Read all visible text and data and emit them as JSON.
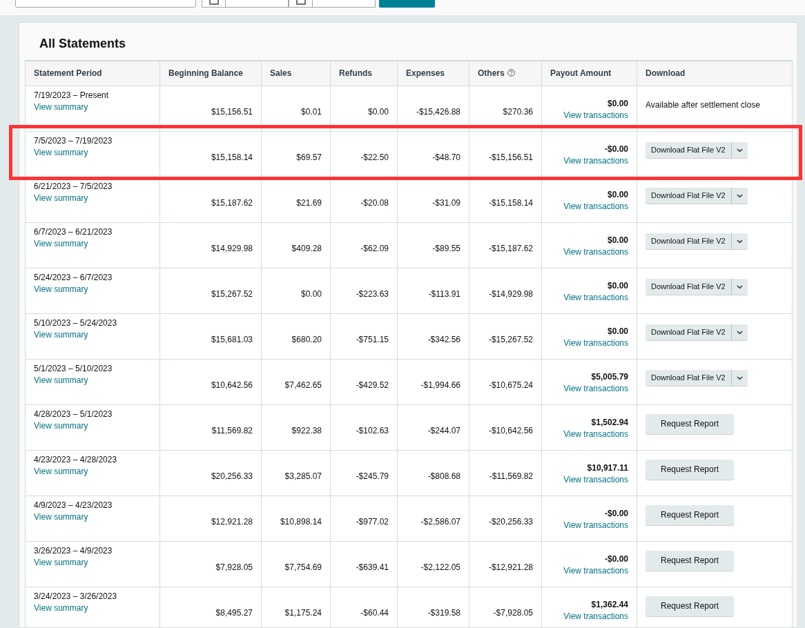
{
  "title": "All Statements",
  "columns": [
    "Statement Period",
    "Beginning Balance",
    "Sales",
    "Refunds",
    "Expenses",
    "Others",
    "Payout Amount",
    "Download"
  ],
  "rows": [
    {
      "period": "7/19/2023 – Present",
      "summary_link": "View summary",
      "beginning": "$15,156.51",
      "sales": "$0.01",
      "refunds": "$0.00",
      "expenses": "-$15,426.88",
      "others": "$270.36",
      "payout": "$0.00",
      "transactions_link": "View transactions",
      "download": {
        "kind": "text",
        "label": "Available after settlement close"
      },
      "highlighted": false
    },
    {
      "period": "7/5/2023 – 7/19/2023",
      "summary_link": "View summary",
      "beginning": "$15,158.14",
      "sales": "$69.57",
      "refunds": "-$22.50",
      "expenses": "-$48.70",
      "others": "-$15,156.51",
      "payout": "-$0.00",
      "transactions_link": "View transactions",
      "download": {
        "kind": "split",
        "label": "Download Flat File V2"
      },
      "highlighted": true
    },
    {
      "period": "6/21/2023 – 7/5/2023",
      "summary_link": "View summary",
      "beginning": "$15,187.62",
      "sales": "$21.69",
      "refunds": "-$20.08",
      "expenses": "-$31.09",
      "others": "-$15,158.14",
      "payout": "$0.00",
      "transactions_link": "View transactions",
      "download": {
        "kind": "split",
        "label": "Download Flat File V2"
      },
      "highlighted": false
    },
    {
      "period": "6/7/2023 – 6/21/2023",
      "summary_link": "View summary",
      "beginning": "$14,929.98",
      "sales": "$409.28",
      "refunds": "-$62.09",
      "expenses": "-$89.55",
      "others": "-$15,187.62",
      "payout": "$0.00",
      "transactions_link": "View transactions",
      "download": {
        "kind": "split",
        "label": "Download Flat File V2"
      },
      "highlighted": false
    },
    {
      "period": "5/24/2023 – 6/7/2023",
      "summary_link": "View summary",
      "beginning": "$15,267.52",
      "sales": "$0.00",
      "refunds": "-$223.63",
      "expenses": "-$113.91",
      "others": "-$14,929.98",
      "payout": "$0.00",
      "transactions_link": "View transactions",
      "download": {
        "kind": "split",
        "label": "Download Flat File V2"
      },
      "highlighted": false
    },
    {
      "period": "5/10/2023 – 5/24/2023",
      "summary_link": "View summary",
      "beginning": "$15,681.03",
      "sales": "$680.20",
      "refunds": "-$751.15",
      "expenses": "-$342.56",
      "others": "-$15,267.52",
      "payout": "$0.00",
      "transactions_link": "View transactions",
      "download": {
        "kind": "split",
        "label": "Download Flat File V2"
      },
      "highlighted": false
    },
    {
      "period": "5/1/2023 – 5/10/2023",
      "summary_link": "View summary",
      "beginning": "$10,642.56",
      "sales": "$7,462.65",
      "refunds": "-$429.52",
      "expenses": "-$1,994.66",
      "others": "-$10,675.24",
      "payout": "$5,005.79",
      "transactions_link": "View transactions",
      "download": {
        "kind": "split",
        "label": "Download Flat File V2"
      },
      "highlighted": false
    },
    {
      "period": "4/28/2023 – 5/1/2023",
      "summary_link": "View summary",
      "beginning": "$11,569.82",
      "sales": "$922.38",
      "refunds": "-$102.63",
      "expenses": "-$244.07",
      "others": "-$10,642.56",
      "payout": "$1,502.94",
      "transactions_link": "View transactions",
      "download": {
        "kind": "button",
        "label": "Request Report"
      },
      "highlighted": false
    },
    {
      "period": "4/23/2023 – 4/28/2023",
      "summary_link": "View summary",
      "beginning": "$20,256.33",
      "sales": "$3,285.07",
      "refunds": "-$245.79",
      "expenses": "-$808.68",
      "others": "-$11,569.82",
      "payout": "$10,917.11",
      "transactions_link": "View transactions",
      "download": {
        "kind": "button",
        "label": "Request Report"
      },
      "highlighted": false
    },
    {
      "period": "4/9/2023 – 4/23/2023",
      "summary_link": "View summary",
      "beginning": "$12,921.28",
      "sales": "$10,898.14",
      "refunds": "-$977.02",
      "expenses": "-$2,586.07",
      "others": "-$20,256.33",
      "payout": "-$0.00",
      "transactions_link": "View transactions",
      "download": {
        "kind": "button",
        "label": "Request Report"
      },
      "highlighted": false
    },
    {
      "period": "3/26/2023 – 4/9/2023",
      "summary_link": "View summary",
      "beginning": "$7,928.05",
      "sales": "$7,754.69",
      "refunds": "-$639.41",
      "expenses": "-$2,122.05",
      "others": "-$12,921.28",
      "payout": "-$0.00",
      "transactions_link": "View transactions",
      "download": {
        "kind": "button",
        "label": "Request Report"
      },
      "highlighted": false
    },
    {
      "period": "3/24/2023 – 3/26/2023",
      "summary_link": "View summary",
      "beginning": "$8,495.27",
      "sales": "$1,175.24",
      "refunds": "-$60.44",
      "expenses": "-$319.58",
      "others": "-$7,928.05",
      "payout": "$1,362.44",
      "transactions_link": "View transactions",
      "download": {
        "kind": "button",
        "label": "Request Report"
      },
      "highlighted": false
    }
  ]
}
